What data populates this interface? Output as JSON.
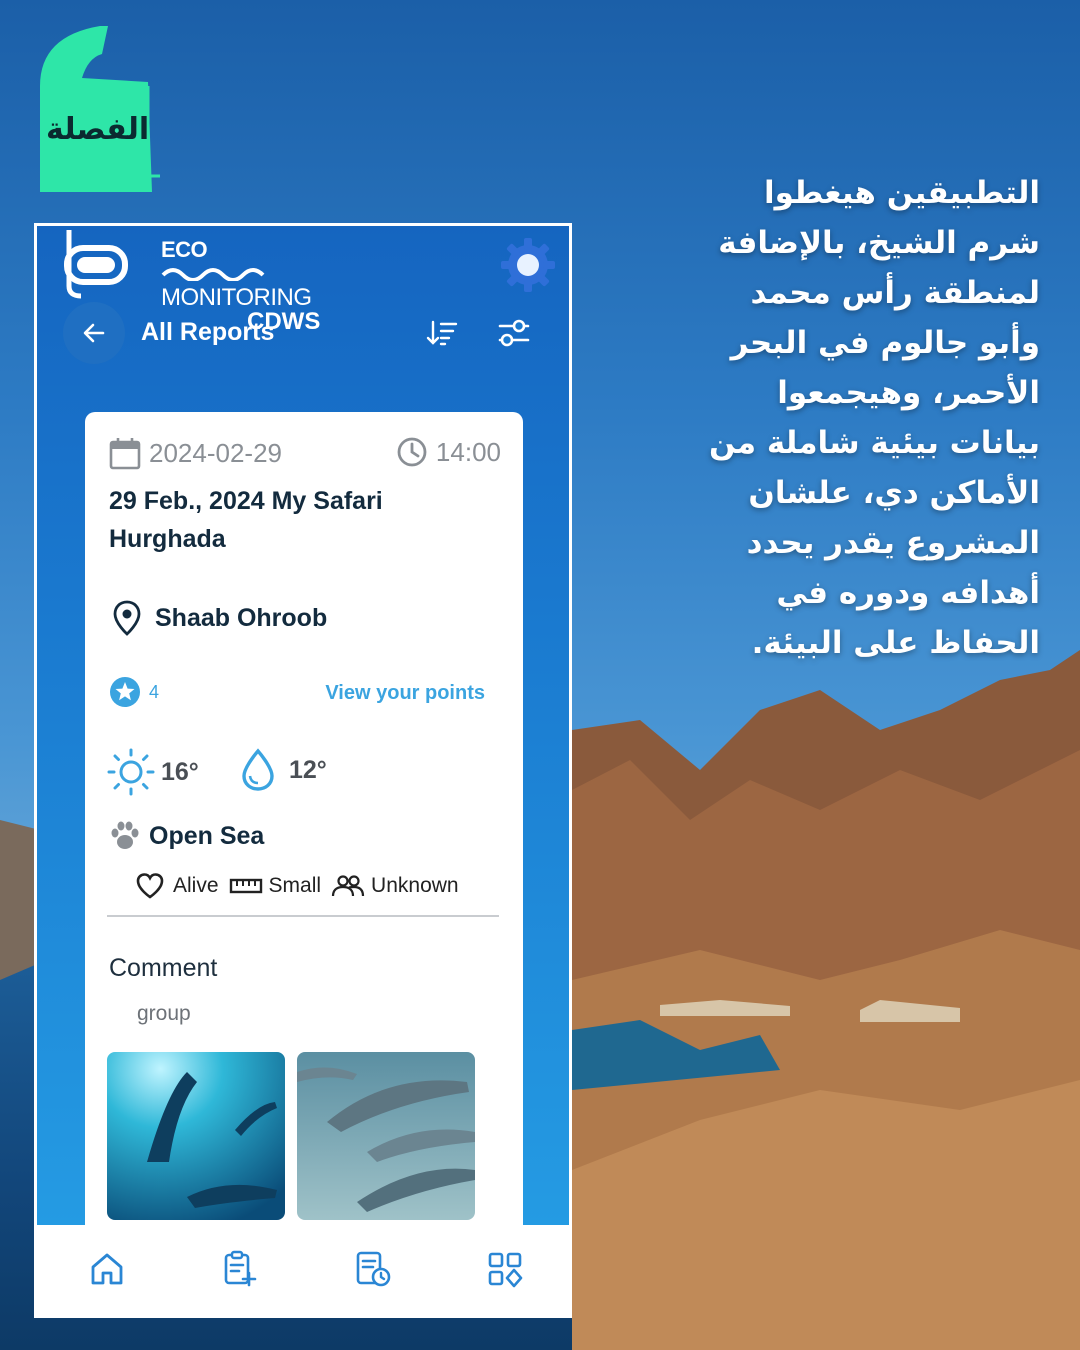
{
  "brand": {
    "name": "الفصلة",
    "color": "#2ee6a8"
  },
  "article": {
    "lines": [
      "التطبيقين هيغطوا",
      "شرم الشيخ، بالإضافة",
      "لمنطقة رأس محمد",
      "وأبو جالوم في البحر",
      "الأحمر، وهيجمعوا",
      "بيانات بيئية شاملة من",
      "الأماكن دي، علشان",
      "المشروع يقدر يحدد",
      "أهدافه ودوره في",
      "الحفاظ على البيئة."
    ]
  },
  "app": {
    "logo": {
      "line1": "ECO",
      "line2": "MONITORING",
      "line3": "CDWS"
    },
    "header": {
      "title": "All Reports",
      "back_icon": "arrow-left-icon",
      "settings_icon": "gear-icon"
    },
    "toolbar": {
      "sort_icon": "sort-icon",
      "filter_icon": "filter-icon"
    },
    "report": {
      "date": "2024-02-29",
      "time": "14:00",
      "title": "29 Feb., 2024 My Safari Hurghada",
      "site": "Shaab Ohroob",
      "points": "4",
      "points_link": "View your points",
      "air_temp": "16°",
      "water_temp": "12°",
      "habitat": "Open Sea",
      "status": "Alive",
      "size": "Small",
      "group": "Unknown",
      "comment_label": "Comment",
      "comment": "group",
      "photos": [
        "dolphins-underwater-photo",
        "dolphins-pod-photo"
      ]
    },
    "nav": [
      "home-icon",
      "add-report-icon",
      "reports-history-icon",
      "apps-grid-icon"
    ],
    "colors": {
      "primary": "#1565c0",
      "accent": "#3ba4e0",
      "text": "#132b3e"
    }
  }
}
